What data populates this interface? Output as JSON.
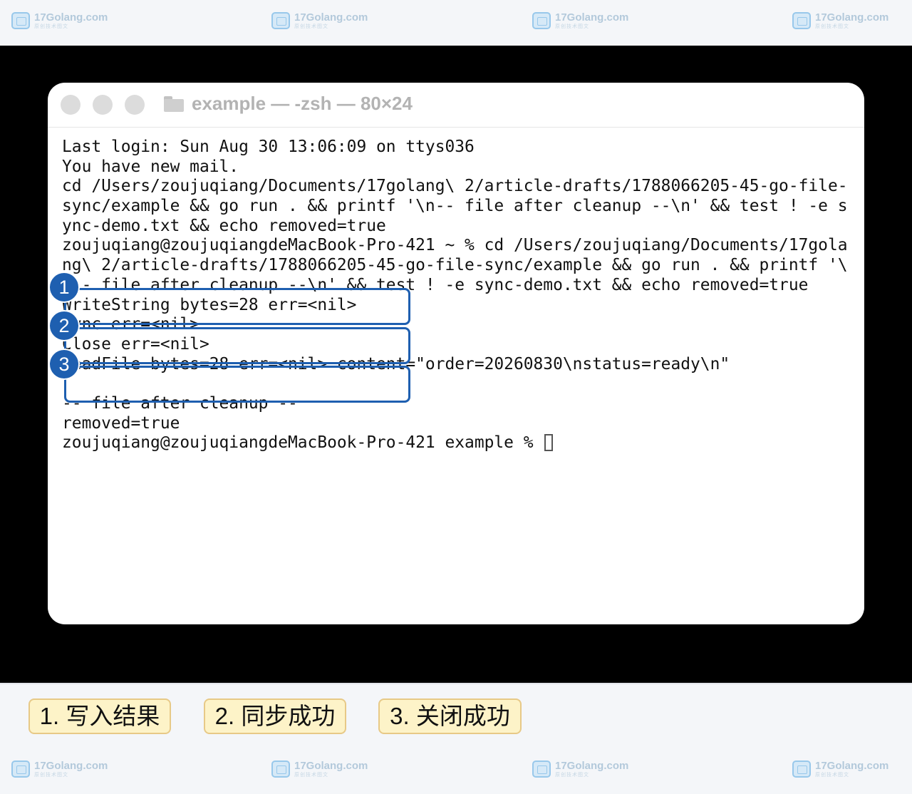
{
  "watermark": {
    "text": "17Golang.com",
    "subtext": "原创技术图文"
  },
  "window": {
    "title": "example — -zsh — 80×24"
  },
  "terminal": {
    "lines": [
      "Last login: Sun Aug 30 13:06:09 on ttys036",
      "You have new mail.",
      "cd /Users/zoujuqiang/Documents/17golang\\ 2/article-drafts/1788066205-45-go-file-",
      "sync/example && go run . && printf '\\n-- file after cleanup --\\n' && test ! -e s",
      "ync-demo.txt && echo removed=true",
      "zoujuqiang@zoujuqiangdeMacBook-Pro-421 ~ % cd /Users/zoujuqiang/Documents/17gola",
      "ng\\ 2/article-drafts/1788066205-45-go-file-sync/example && go run . && printf '\\",
      "n-- file after cleanup --\\n' && test ! -e sync-demo.txt && echo removed=true",
      "WriteString bytes=28 err=<nil>",
      "Sync err=<nil>",
      "Close err=<nil>",
      "ReadFile bytes=28 err=<nil> content=\"order=20260830\\nstatus=ready\\n\"",
      "",
      "-- file after cleanup --",
      "removed=true"
    ],
    "prompt": "zoujuqiang@zoujuqiangdeMacBook-Pro-421 example % "
  },
  "highlights": [
    {
      "badge": "1"
    },
    {
      "badge": "2"
    },
    {
      "badge": "3"
    }
  ],
  "legend": [
    {
      "label": "1. 写入结果"
    },
    {
      "label": "2. 同步成功"
    },
    {
      "label": "3. 关闭成功"
    }
  ],
  "colors": {
    "highlight": "#1e5fb0",
    "legend_bg": "#fdf3c8",
    "legend_border": "#e7c987",
    "watermark": "#7fa6c4"
  },
  "icons": {
    "title_icon": "folder-icon",
    "watermark_icon": "site-logo-icon"
  }
}
